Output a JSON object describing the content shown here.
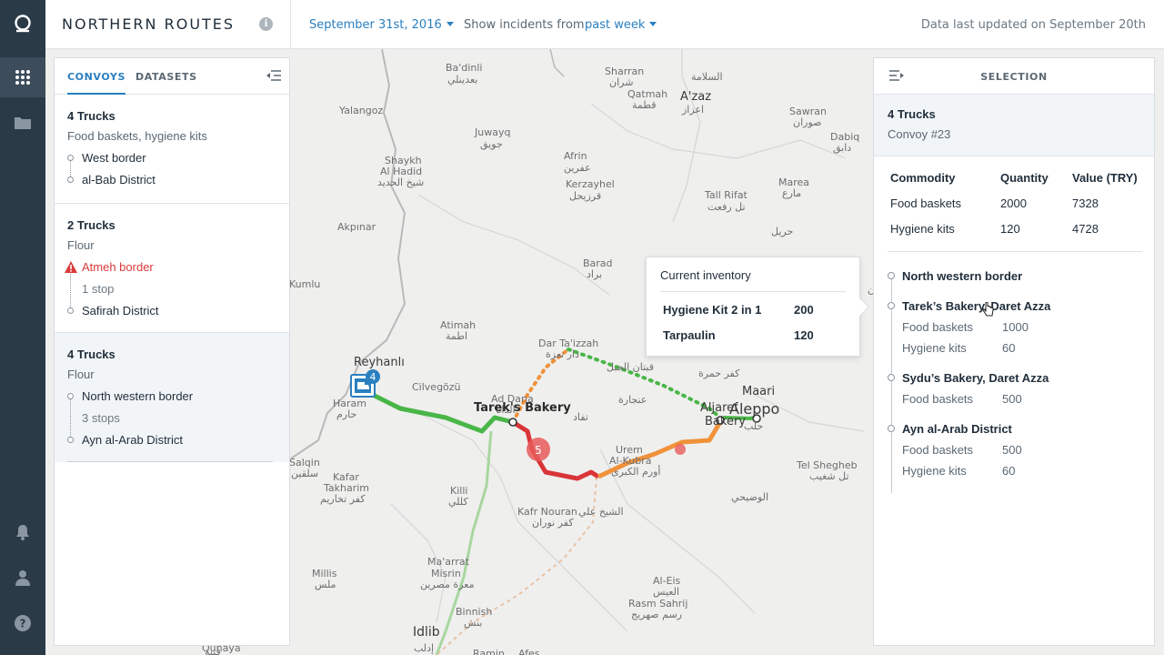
{
  "app": {
    "title": "NORTHERN ROUTES",
    "date": "September 31st, 2016",
    "incidents_label": "Show incidents from",
    "incidents_range": "past week",
    "updated": "Data last updated on September 20th"
  },
  "left_panel": {
    "tabs": [
      "CONVOYS",
      "DATASETS"
    ],
    "convoys": [
      {
        "title": "4 Trucks",
        "subtitle": "Food baskets, hygiene kits",
        "stops": [
          "West border",
          "al-Bab District"
        ]
      },
      {
        "title": "2 Trucks",
        "subtitle": "Flour",
        "alert_stop": "Atmeh border",
        "middle": "1 stop",
        "end": "Safirah District"
      },
      {
        "title": "4 Trucks",
        "subtitle": "Flour",
        "start": "North western border",
        "middle": "3 stops",
        "end": "Ayn al-Arab District"
      }
    ]
  },
  "right_panel": {
    "header": "SELECTION",
    "summary_title": "4 Trucks",
    "summary_sub": "Convoy #23",
    "table_headers": [
      "Commodity",
      "Quantity",
      "Value (TRY)"
    ],
    "table_rows": [
      [
        "Food baskets",
        "2000",
        "7328"
      ],
      [
        "Hygiene kits",
        "120",
        "4728"
      ]
    ],
    "route": [
      {
        "name": "North western border",
        "items": []
      },
      {
        "name": "Tarek’s Bakery, Daret Azza",
        "items": [
          [
            "Food baskets",
            "1000"
          ],
          [
            "Hygiene kits",
            "60"
          ]
        ]
      },
      {
        "name": "Sydu’s Bakery, Daret Azza",
        "items": [
          [
            "Food baskets",
            "500"
          ]
        ]
      },
      {
        "name": "Ayn al-Arab District",
        "items": [
          [
            "Food baskets",
            "500"
          ],
          [
            "Hygiene kits",
            "60"
          ]
        ]
      }
    ]
  },
  "tooltip": {
    "title": "Current inventory",
    "rows": [
      [
        "Hygiene Kit 2 in 1",
        "200"
      ],
      [
        "Tarpaulin",
        "120"
      ]
    ]
  },
  "map": {
    "convoy_badge": "4",
    "incident_badge": "5",
    "labels": {
      "reyhanli": "Reyhanlı",
      "tareks": "Tarek's Bakery",
      "aleppo": "Aleppo",
      "idlib": "Idlib",
      "aljaraf_bakery": "Bakery",
      "aljaraf": "Aljaref"
    },
    "place_names": [
      "Ba'dinli",
      "بعدينلي",
      "Sharran",
      "شران",
      "السلامة",
      "A'zaz",
      "اعزاز",
      "Qatmah",
      "قطمة",
      "Sawran",
      "صوران",
      "Yalangoz",
      "Juwayq",
      "جويق",
      "Afrin",
      "عفرين",
      "Kerzayhel",
      "قرزيحل",
      "Dabiq",
      "دابق",
      "Shaykh",
      "Al Hadid",
      "شيخ الحديد",
      "Tall Rifat",
      "تل رفعت",
      "Marea",
      "مارع",
      "حريل",
      "Akpınar",
      "Barad",
      "براد",
      "Kumlu",
      "Atimah",
      "اطمة",
      "Dar Ta'izzah",
      "دار تعزة",
      "قبتان الجبل",
      "كفر حمرة",
      "Maari",
      "Cilvegözü",
      "Haram",
      "حارم",
      "Ad Dana",
      "الدانا",
      "تفاد",
      "عنجارة",
      "Salqin",
      "سلقين",
      "Kafar",
      "Takharim",
      "كفر تخاريم",
      "Killi",
      "كللي",
      "Urem",
      "Al-Kubra",
      "أورم الكبرى",
      "Tel Shegheb",
      "تل شغيب",
      "الوضيحي",
      "Kafr Nouran",
      "كفر نوران",
      "الشيخ علي",
      "Ma'arrat",
      "Misrin",
      "معرة مصرين",
      "Millis",
      "ملس",
      "Binnish",
      "بنش",
      "Al-Eis",
      "العيس",
      "Rasm Sahrij",
      "رسم صهريج",
      "إدلب",
      "Qunaya",
      "قنية",
      "Ramin",
      "Afes",
      "حلب",
      "خان"
    ]
  }
}
